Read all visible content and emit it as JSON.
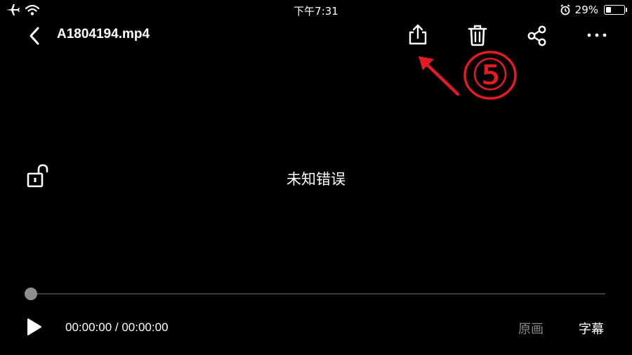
{
  "status_bar": {
    "time": "下午7:31",
    "battery_percent": "29%",
    "battery_level": 0.29,
    "icons": [
      "airplane-icon",
      "wifi-icon",
      "alarm-icon",
      "battery-icon"
    ]
  },
  "nav": {
    "title": "A1804194.mp4",
    "icons": [
      "back-chevron-icon",
      "export-icon",
      "trash-icon",
      "share-icon",
      "more-icon"
    ]
  },
  "annotation": {
    "label": "⑤",
    "color": "#e31b23"
  },
  "player": {
    "error_text": "未知错误",
    "progress": 0.0,
    "time_display": "00:00:00 / 00:00:00",
    "buttons": {
      "original": "原画",
      "subtitle": "字幕"
    }
  }
}
